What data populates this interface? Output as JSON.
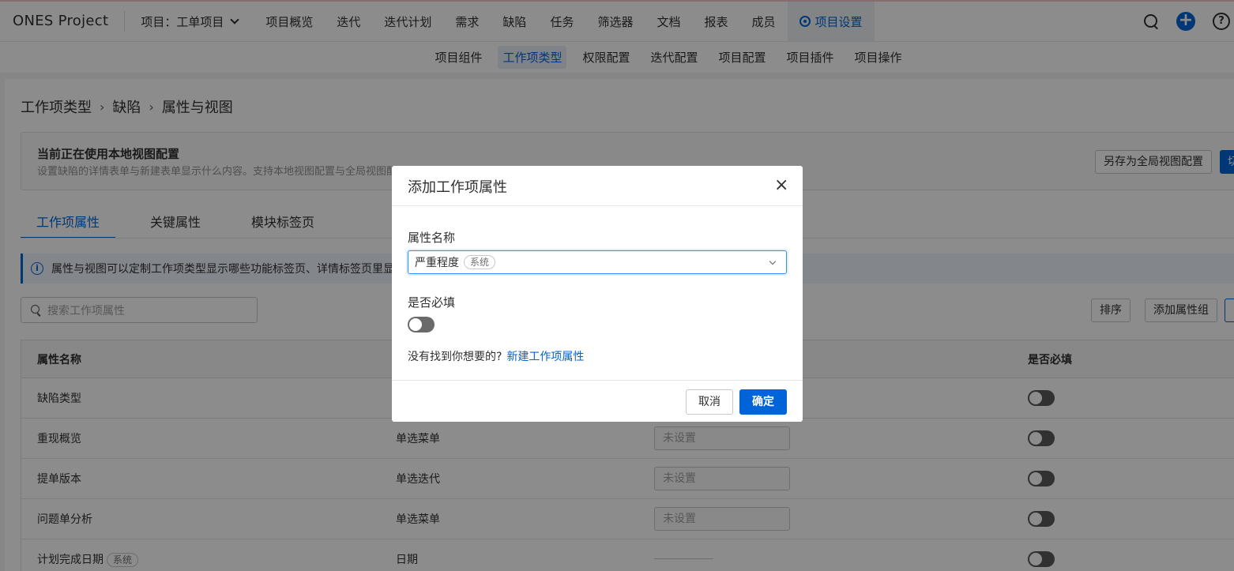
{
  "topbar": {
    "brand": "ONES Project",
    "project_label": "项目：工单项目",
    "nav": [
      "项目概览",
      "迭代",
      "迭代计划",
      "需求",
      "缺陷",
      "任务",
      "筛选器",
      "文档",
      "报表",
      "成员"
    ],
    "active_nav": "项目设置"
  },
  "subnav": {
    "items": [
      "项目组件",
      "工作项类型",
      "权限配置",
      "迭代配置",
      "项目配置",
      "项目插件",
      "项目操作"
    ],
    "active_index": 1
  },
  "breadcrumb": {
    "level1": "工作项类型",
    "level2": "缺陷",
    "level3": "属性与视图"
  },
  "config": {
    "title": "当前正在使用本地视图配置",
    "desc": "设置缺陷的详情表单与新建表单显示什么内容。支持本地视图配置与全局视图配置",
    "save_global_label": "另存为全局视图配置",
    "switch_label": "切"
  },
  "tabs": [
    "工作项属性",
    "关键属性",
    "模块标签页"
  ],
  "info": {
    "text": "属性与视图可以定制工作项类型显示哪些功能标签页、详情标签页里显示哪些属性"
  },
  "search": {
    "placeholder": "搜索工作项属性"
  },
  "toolbar": {
    "sort_label": "排序",
    "add_group_label": "添加属性组"
  },
  "table": {
    "headers": {
      "name": "属性名称",
      "required": "是否必填"
    },
    "rows": [
      {
        "name": "缺陷类型",
        "type": "",
        "default": "",
        "tag": ""
      },
      {
        "name": "重现概览",
        "type": "单选菜单",
        "default": "未设置",
        "tag": ""
      },
      {
        "name": "提单版本",
        "type": "单选迭代",
        "default": "未设置",
        "tag": ""
      },
      {
        "name": "问题单分析",
        "type": "单选菜单",
        "default": "未设置",
        "tag": ""
      },
      {
        "name": "计划完成日期",
        "type": "日期",
        "default": "",
        "tag": "系统"
      }
    ]
  },
  "modal": {
    "title": "添加工作项属性",
    "close_icon": "×",
    "field_name_label": "属性名称",
    "field_name_value": "严重程度",
    "field_name_tag": "系统",
    "required_label": "是否必填",
    "notfound_text": "没有找到你想要的?",
    "notfound_link": "新建工作项属性",
    "cancel_label": "取消",
    "ok_label": "确定"
  }
}
